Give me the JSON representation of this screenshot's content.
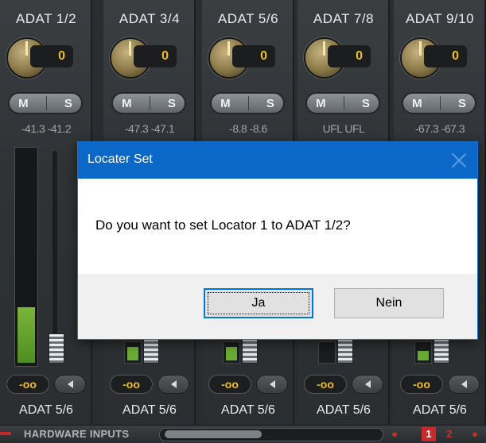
{
  "channels": [
    {
      "label": "ADAT 1/2",
      "gain": "0",
      "mute": "M",
      "solo": "S",
      "level": "-41.3 -41.2",
      "volume": "-oo",
      "route": "ADAT 5/6"
    },
    {
      "label": "ADAT 3/4",
      "gain": "0",
      "mute": "M",
      "solo": "S",
      "level": "-47.3 -47.1",
      "volume": "-oo",
      "route": "ADAT 5/6"
    },
    {
      "label": "ADAT 5/6",
      "gain": "0",
      "mute": "M",
      "solo": "S",
      "level": "-8.8  -8.6",
      "volume": "-oo",
      "route": "ADAT 5/6"
    },
    {
      "label": "ADAT 7/8",
      "gain": "0",
      "mute": "M",
      "solo": "S",
      "level": "UFL  UFL",
      "volume": "-oo",
      "route": "ADAT 5/6"
    },
    {
      "label": "ADAT 9/10",
      "gain": "0",
      "mute": "M",
      "solo": "S",
      "level": "-67.3 -67.3",
      "volume": "-oo",
      "route": "ADAT 5/6"
    }
  ],
  "bottom_bar": {
    "label": "HARDWARE INPUTS",
    "pages": [
      "1",
      "2"
    ],
    "active_page": "1"
  },
  "dialog": {
    "title": "Locater Set",
    "message": "Do you want to set Locator 1 to ADAT 1/2?",
    "yes_label": "Ja",
    "no_label": "Nein"
  },
  "colors": {
    "accent": "#0c68c8",
    "value_text": "#f0c020",
    "meter_green": "#69ab34",
    "page_red": "#c72a2a"
  }
}
